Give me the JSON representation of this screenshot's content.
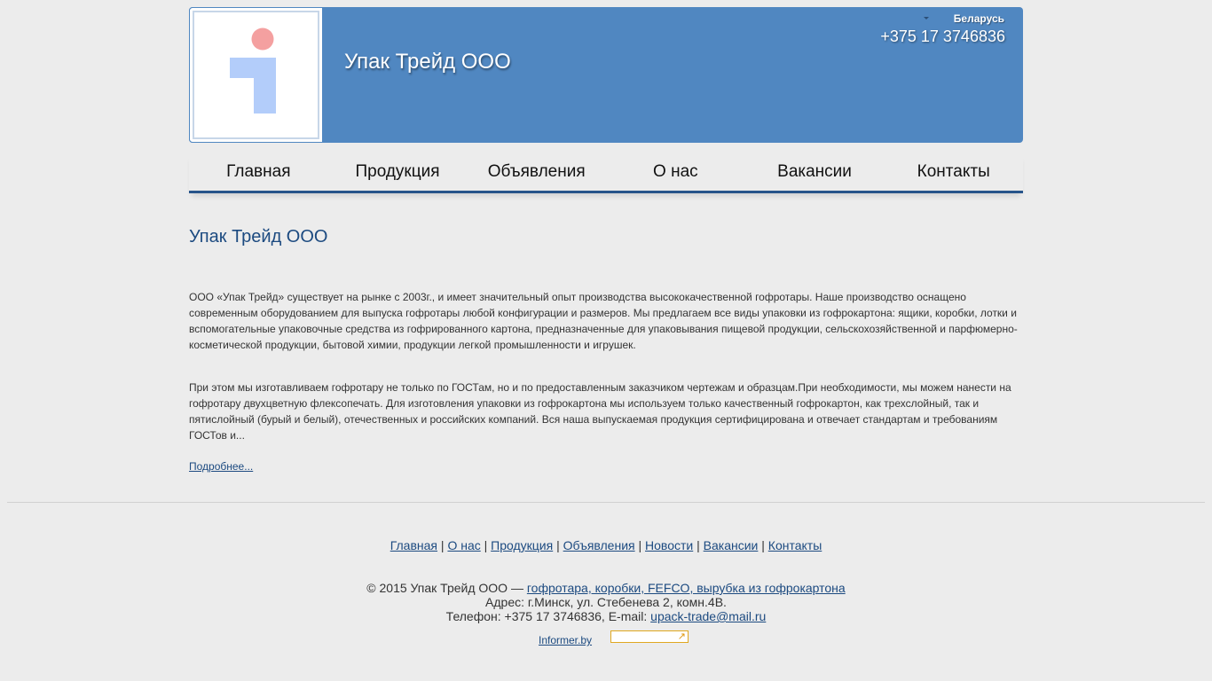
{
  "header": {
    "site_title": "Упак Трейд ООО",
    "region": "Беларусь",
    "phone": "+375 17 3746836",
    "accent_color": "#5087c1"
  },
  "nav": {
    "items": [
      {
        "label": "Главная"
      },
      {
        "label": "Продукция"
      },
      {
        "label": "Объявления"
      },
      {
        "label": "О нас"
      },
      {
        "label": "Вакансии"
      },
      {
        "label": "Контакты"
      }
    ]
  },
  "main": {
    "title": "Упак Трейд ООО",
    "paragraph1": "ООО «Упак Трейд» существует на рынке с 2003г., и имеет значительный опыт производства высококачественной гофротары. Наше производство оснащено современным оборудованием для выпуска гофротары любой конфигурации и размеров. Мы предлагаем все виды упаковки из гофрокартона: ящики, коробки, лотки и вспомогательные упаковочные средства из гофрированного картона, предназначенные для упаковывания пищевой продукции, сельскохозяйственной и парфюмерно-косметической продукции, бытовой химии, продукции легкой промышленности и игрушек.",
    "paragraph2": "При этом мы изготавливаем гофротару не только по ГОСТам, но и по предоставленным заказчиком чертежам и образцам.При необходимости, мы можем нанести на гофротару двухцветную флексопечать. Для изготовления упаковки из гофрокартона мы используем только качественный гофрокартон, как трехслойный, так и пятислойный (бурый и белый), отечественных и российских компаний. Вся наша выпускаемая продукция сертифицирована и отвечает стандартам и требованиям ГОСТов и...",
    "more_link": "Подробнее..."
  },
  "footer": {
    "links": [
      {
        "label": "Главная"
      },
      {
        "label": "О нас"
      },
      {
        "label": "Продукция"
      },
      {
        "label": "Объявления"
      },
      {
        "label": "Новости"
      },
      {
        "label": "Вакансии"
      },
      {
        "label": "Контакты"
      }
    ],
    "separator": "|",
    "copyright_prefix": "© 2015 Упак Трейд ООО —",
    "copyright_link": "гофротара, коробки, FEFCO, вырубка из гофрокартона",
    "address": "Адрес: г.Минск, ул. Стебенева 2, комн.4В.",
    "phone_prefix": "Телефон: +375 17 3746836, E-mail:",
    "email": "upack-trade@mail.ru",
    "informer_link": "Informer.by",
    "informer_icon": "arrow-up-right-icon"
  }
}
